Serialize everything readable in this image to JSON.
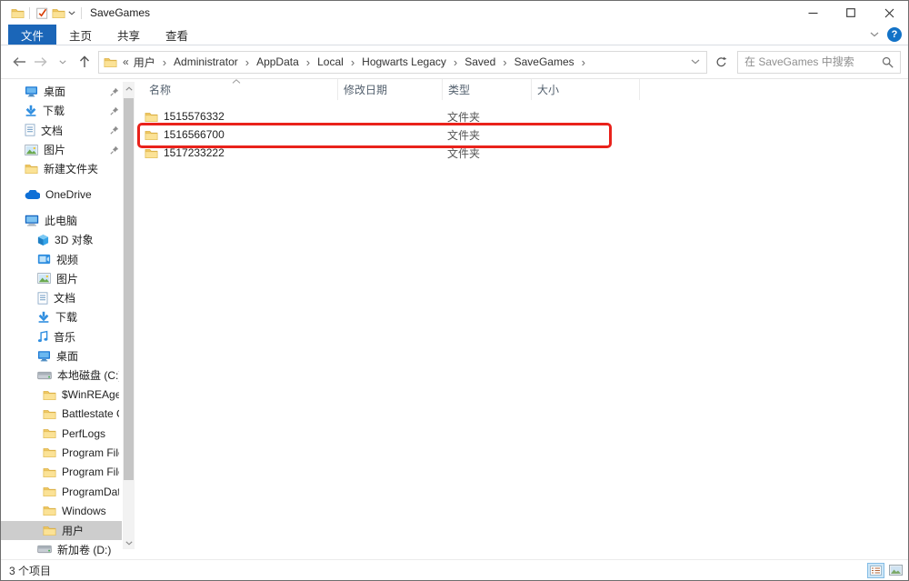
{
  "colors": {
    "accent": "#1b66b8",
    "annotation_red": "#e9221b",
    "selection_gray": "#cdcdcd",
    "folder_yellow": "#fbe296"
  },
  "titlebar": {
    "title": "SaveGames"
  },
  "ribbon": {
    "tabs": [
      {
        "label": "文件",
        "active": true
      },
      {
        "label": "主页",
        "active": false
      },
      {
        "label": "共享",
        "active": false
      },
      {
        "label": "查看",
        "active": false
      }
    ]
  },
  "toolbar": {
    "breadcrumb": {
      "prefix": "«",
      "separator": "›",
      "items": [
        "用户",
        "Administrator",
        "AppData",
        "Local",
        "Hogwarts Legacy",
        "Saved",
        "SaveGames"
      ]
    },
    "search_placeholder": "在 SaveGames 中搜索"
  },
  "sidebar": {
    "items": [
      {
        "label": "桌面",
        "icon": "desktop",
        "level": 0,
        "pinned": true
      },
      {
        "label": "下载",
        "icon": "download",
        "level": 0,
        "pinned": true
      },
      {
        "label": "文档",
        "icon": "document",
        "level": 0,
        "pinned": true
      },
      {
        "label": "图片",
        "icon": "picture",
        "level": 0,
        "pinned": true
      },
      {
        "label": "新建文件夹",
        "icon": "folder",
        "level": 0
      },
      {
        "label": "OneDrive",
        "icon": "onedrive",
        "level": 0,
        "gap": true
      },
      {
        "label": "此电脑",
        "icon": "computer",
        "level": 0,
        "gap": true
      },
      {
        "label": "3D 对象",
        "icon": "cube3d",
        "level": 1
      },
      {
        "label": "视频",
        "icon": "video",
        "level": 1
      },
      {
        "label": "图片",
        "icon": "picture",
        "level": 1
      },
      {
        "label": "文档",
        "icon": "document",
        "level": 1
      },
      {
        "label": "下载",
        "icon": "download",
        "level": 1
      },
      {
        "label": "音乐",
        "icon": "music",
        "level": 1
      },
      {
        "label": "桌面",
        "icon": "desktop",
        "level": 1
      },
      {
        "label": "本地磁盘 (C:)",
        "icon": "drive",
        "level": 1
      },
      {
        "label": "$WinREAgent",
        "icon": "folder",
        "level": 2
      },
      {
        "label": "Battlestate Ga",
        "icon": "folder",
        "level": 2
      },
      {
        "label": "PerfLogs",
        "icon": "folder",
        "level": 2
      },
      {
        "label": "Program Files",
        "icon": "folder",
        "level": 2
      },
      {
        "label": "Program Files",
        "icon": "folder",
        "level": 2
      },
      {
        "label": "ProgramData",
        "icon": "folder",
        "level": 2
      },
      {
        "label": "Windows",
        "icon": "folder",
        "level": 2
      },
      {
        "label": "用户",
        "icon": "folder",
        "level": 2,
        "selected": true
      },
      {
        "label": "新加卷 (D:)",
        "icon": "drive",
        "level": 1
      }
    ]
  },
  "main": {
    "columns": [
      "名称",
      "修改日期",
      "类型",
      "大小"
    ],
    "rows": [
      {
        "name": "1515576332",
        "date": "",
        "type": "文件夹",
        "size": ""
      },
      {
        "name": "1516566700",
        "date": "",
        "type": "文件夹",
        "size": "",
        "annotated": true
      },
      {
        "name": "1517233222",
        "date": "",
        "type": "文件夹",
        "size": ""
      }
    ]
  },
  "statusbar": {
    "count": "3 个项目"
  }
}
